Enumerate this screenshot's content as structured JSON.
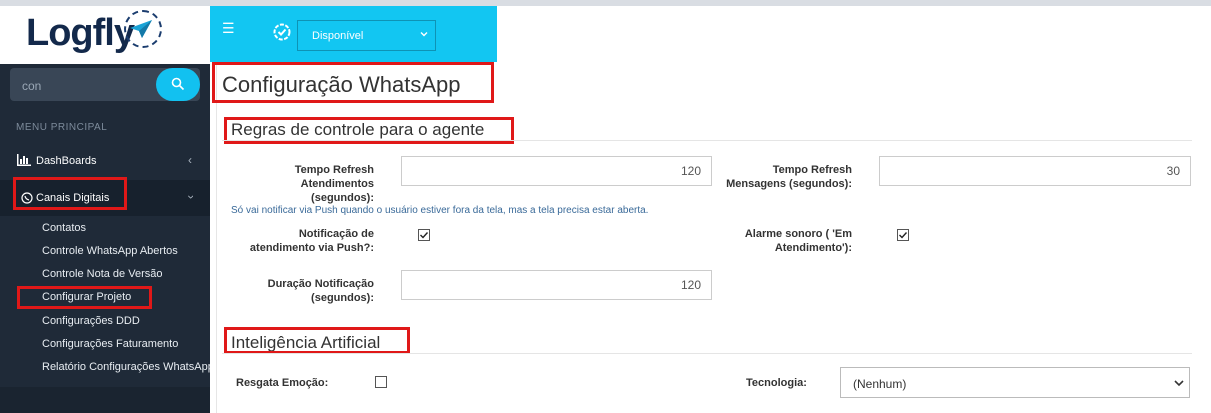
{
  "brand": {
    "logo_text": "Logfly"
  },
  "sidebar": {
    "search": {
      "value": "con"
    },
    "menu_header": "MENU PRINCIPAL",
    "items": [
      {
        "label": "DashBoards"
      },
      {
        "label": "Canais Digitais"
      }
    ],
    "subitems": [
      {
        "label": "Contatos"
      },
      {
        "label": "Controle WhatsApp Abertos"
      },
      {
        "label": "Controle Nota de Versão"
      },
      {
        "label": "Configurar Projeto"
      },
      {
        "label": "Configurações DDD"
      },
      {
        "label": "Configurações Faturamento"
      },
      {
        "label": "Relatório Configurações WhatsApp"
      }
    ]
  },
  "header": {
    "status_value": "Disponível"
  },
  "page": {
    "title": "Configuração WhatsApp",
    "section1": "Regras de controle para o agente",
    "section2": "Inteligência Artificial",
    "fields": {
      "refresh_atend_label_1": "Tempo Refresh",
      "refresh_atend_label_2": "Atendimentos",
      "refresh_atend_label_3": "(segundos):",
      "refresh_atend_value": "120",
      "refresh_msg_label_1": "Tempo Refresh",
      "refresh_msg_label_2": "Mensagens (segundos):",
      "refresh_msg_value": "30",
      "hint": "Só vai notificar via Push quando o usuário estiver fora da tela, mas a tela precisa estar aberta.",
      "push_label_1": "Notificação de",
      "push_label_2": "atendimento via Push?:",
      "push_checked": true,
      "alarm_label_1": "Alarme sonoro ( 'Em",
      "alarm_label_2": "Atendimento'):",
      "alarm_checked": true,
      "duracao_label_1": "Duração Notificação",
      "duracao_label_2": "(segundos):",
      "duracao_value": "120",
      "resgata_label": "Resgata Emoção:",
      "resgata_checked": false,
      "tecnologia_label": "Tecnologia:",
      "tecnologia_value": "(Nenhum)"
    }
  },
  "colors": {
    "sidebar_bg": "#1f2a38",
    "accent": "#12c6f2",
    "highlight_border": "#e01818"
  }
}
